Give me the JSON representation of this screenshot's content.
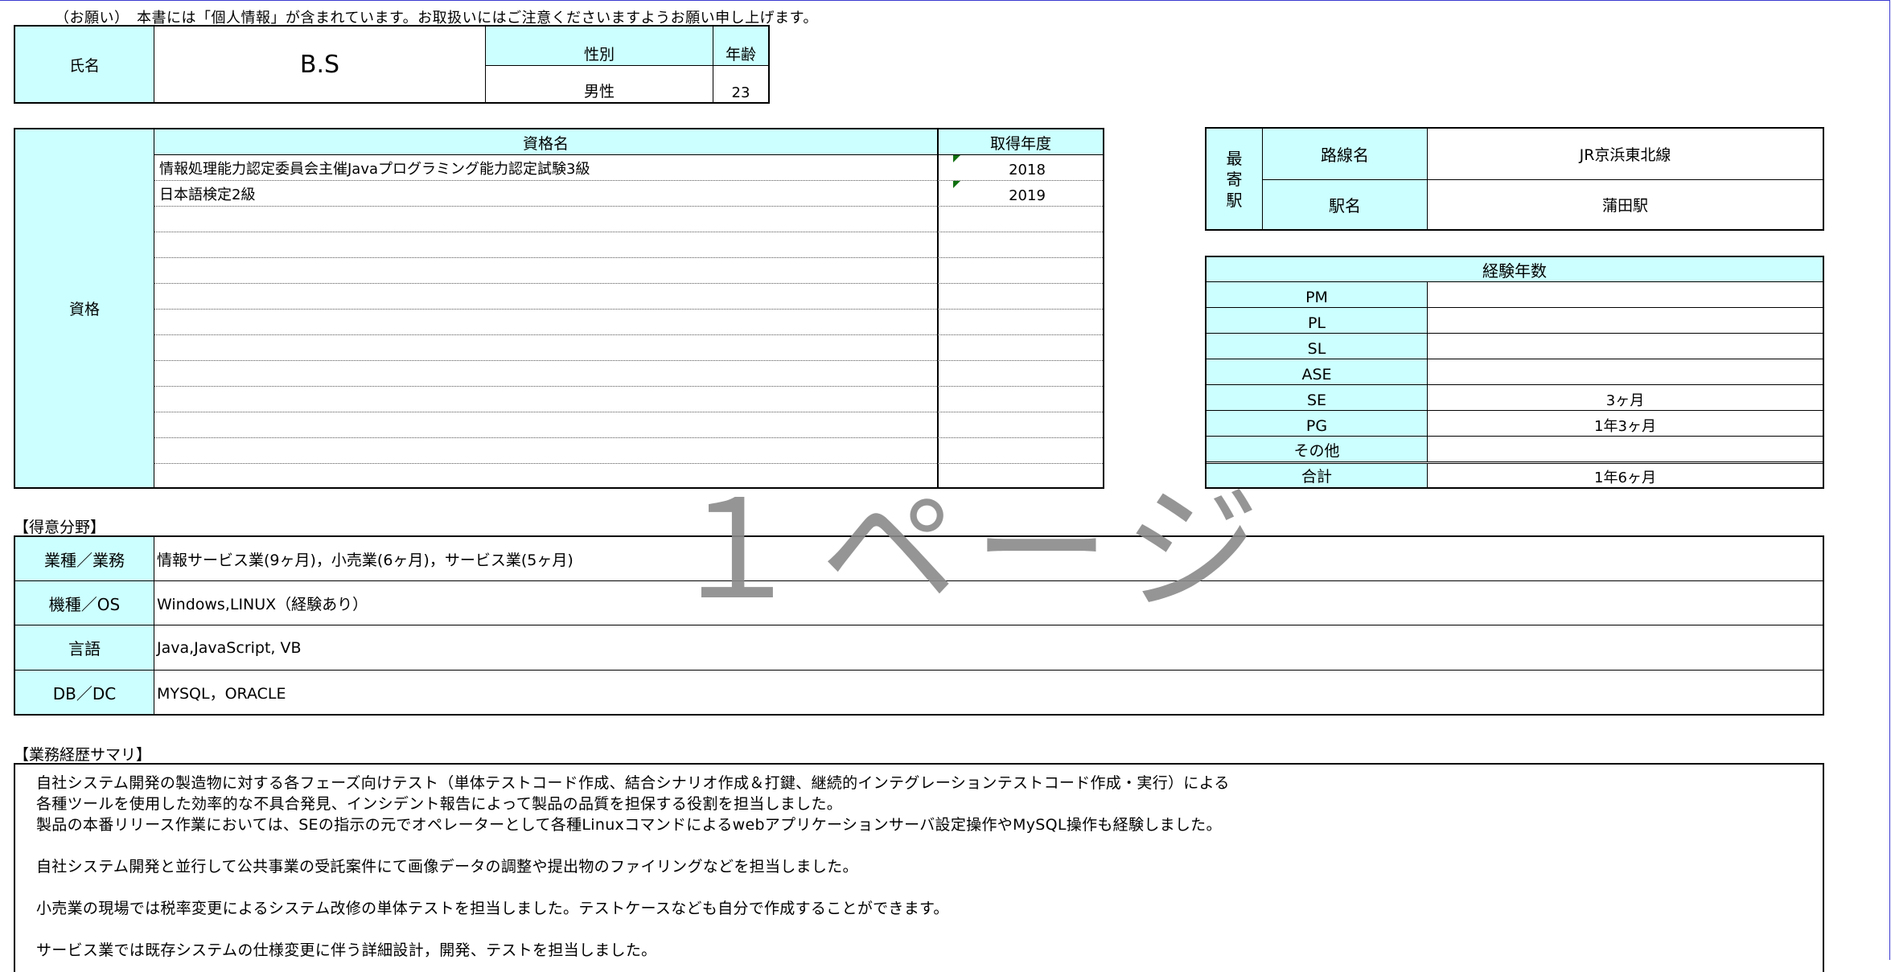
{
  "notice": "（お願い）　本書には「個人情報」が含まれています。お取扱いにはご注意くださいますようお願い申し上げます。",
  "profile": {
    "name_label": "氏名",
    "name_value": "B.S",
    "gender_label": "性別",
    "gender_value": "男性",
    "age_label": "年齢",
    "age_value": "23"
  },
  "qualifications": {
    "section_label": "資格",
    "col_name": "資格名",
    "col_year": "取得年度",
    "rows": [
      {
        "name": "情報処理能力認定委員会主催Javaプログラミング能力認定試験3級",
        "year": "2018"
      },
      {
        "name": "日本語検定2級",
        "year": "2019"
      },
      {
        "name": "",
        "year": ""
      },
      {
        "name": "",
        "year": ""
      },
      {
        "name": "",
        "year": ""
      },
      {
        "name": "",
        "year": ""
      },
      {
        "name": "",
        "year": ""
      },
      {
        "name": "",
        "year": ""
      },
      {
        "name": "",
        "year": ""
      },
      {
        "name": "",
        "year": ""
      },
      {
        "name": "",
        "year": ""
      },
      {
        "name": "",
        "year": ""
      },
      {
        "name": "",
        "year": ""
      }
    ]
  },
  "station": {
    "label_chars": [
      "最",
      "寄",
      "駅"
    ],
    "line_label": "路線名",
    "line_value": "JR京浜東北線",
    "station_label": "駅名",
    "station_value": "蒲田駅"
  },
  "experience": {
    "title": "経験年数",
    "rows": [
      {
        "label": "PM",
        "value": ""
      },
      {
        "label": "PL",
        "value": ""
      },
      {
        "label": "SL",
        "value": ""
      },
      {
        "label": "ASE",
        "value": ""
      },
      {
        "label": "SE",
        "value": "3ヶ月"
      },
      {
        "label": "PG",
        "value": "1年3ヶ月"
      },
      {
        "label": "その他",
        "value": ""
      },
      {
        "label": "合計",
        "value": "1年6ヶ月"
      }
    ]
  },
  "specialty": {
    "heading": "【得意分野】",
    "rows": [
      {
        "label": "業種／業務",
        "value": "情報サービス業(9ヶ月)，小売業(6ヶ月)，サービス業(5ヶ月)"
      },
      {
        "label": "機種／OS",
        "value": "Windows,LINUX（経験あり）"
      },
      {
        "label": "言語",
        "value": "Java,JavaScript, VB"
      },
      {
        "label": "DB／DC",
        "value": "MYSQL，ORACLE"
      }
    ]
  },
  "summary": {
    "heading": "【業務経歴サマリ】",
    "lines": [
      "自社システム開発の製造物に対する各フェーズ向けテスト（単体テストコード作成、結合シナリオ作成＆打鍵、継続的インテグレーションテストコード作成・実行）による",
      "各種ツールを使用した効率的な不具合発見、インシデント報告によって製品の品質を担保する役割を担当しました。",
      "製品の本番リリース作業においては、SEの指示の元でオペレーターとして各種Linuxコマンドによるwebアプリケーションサーバ設定操作やMySQL操作も経験しました。",
      "自社システム開発と並行して公共事業の受託案件にて画像データの調整や提出物のファイリングなどを担当しました。",
      "小売業の現場では税率変更によるシステム改修の単体テストを担当しました。テストケースなども自分で作成することができます。",
      "サービス業では既存システムの仕様変更に伴う詳細設計，開発、テストを担当しました。"
    ]
  },
  "watermark": "１ページ"
}
